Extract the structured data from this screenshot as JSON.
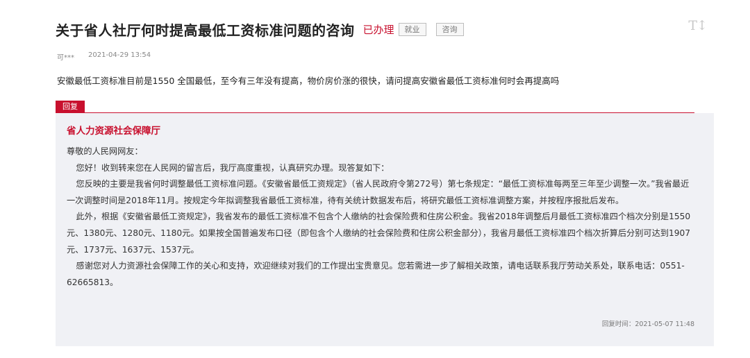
{
  "title": "关于省人社厅何时提高最低工资标准问题的咨询",
  "status": "已办理",
  "tags": [
    "就业",
    "咨询"
  ],
  "font_toggle": "T↕",
  "author": "可***",
  "posted_time": "2021-04-29 13:54",
  "question": "安徽最低工资标准目前是1550 全国最低，至今有三年没有提高，物价房价涨的很快，请问提高安徽省最低工资标准何时会再提高吗",
  "reply_label": "回复",
  "reply": {
    "department": "省人力资源社会保障厅",
    "greeting": "尊敬的人民网网友：",
    "paragraphs": [
      "您好！收到转来您在人民网的留言后，我厅高度重视，认真研究办理。现答复如下：",
      "您反映的主要是我省何时调整最低工资标准问题。《安徽省最低工资规定》（省人民政府令第272号）第七条规定：“最低工资标准每两至三年至少调整一次。”我省最近一次调整时间是2018年11月。按规定今年拟调整我省最低工资标准，待有关统计数据发布后，将研究最低工资标准调整方案，并按程序报批后发布。",
      "此外，根据《安徽省最低工资规定》，我省发布的最低工资标准不包含个人缴纳的社会保险费和住房公积金。我省2018年调整后月最低工资标准四个档次分别是1550元、1380元、1280元、1180元。如果按全国普遍发布口径（即包含个人缴纳的社会保险费和住房公积金部分），我省月最低工资标准四个档次折算后分别可达到1907元、1737元、1637元、1537元。",
      "感谢您对人力资源社会保障工作的关心和支持，欢迎继续对我们的工作提出宝贵意见。您若需进一步了解相关政策，请电话联系我厅劳动关系处，联系电话：0551-62665813。"
    ],
    "reply_time": "回复时间：2021-05-07 11:48"
  },
  "colors": {
    "accent": "#c8102e",
    "reply_bg": "#f0f1f5"
  }
}
